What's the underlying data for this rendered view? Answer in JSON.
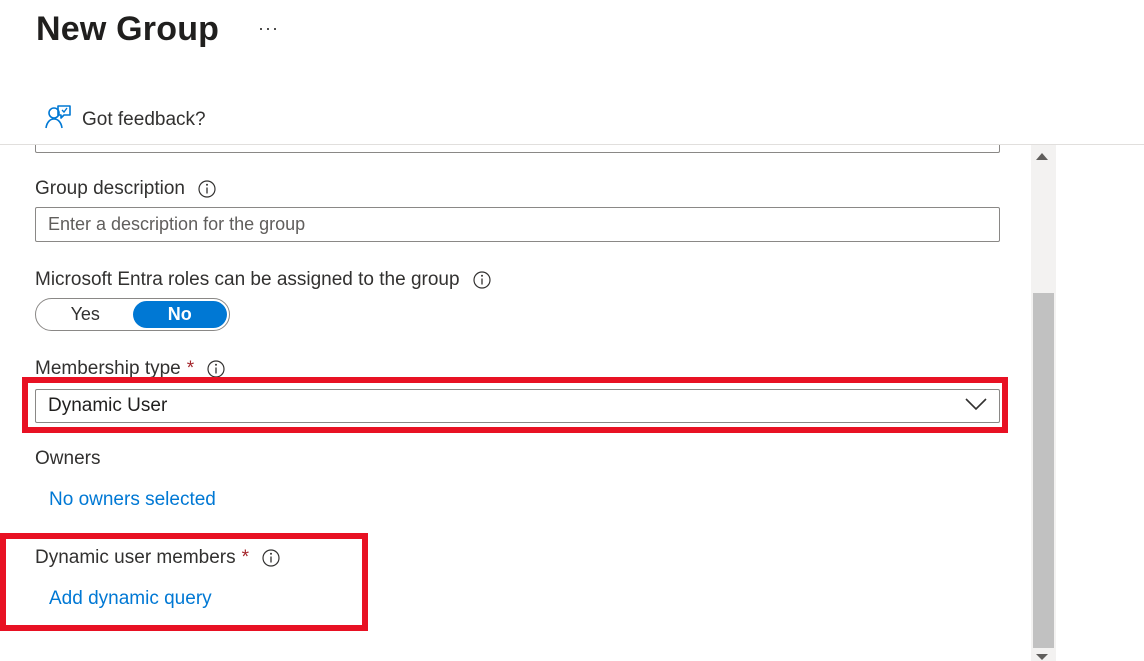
{
  "header": {
    "title": "New Group",
    "more_label": "···"
  },
  "toolbar": {
    "feedback_label": "Got feedback?"
  },
  "form": {
    "description": {
      "label": "Group description",
      "placeholder": "Enter a description for the group",
      "value": ""
    },
    "entra_roles": {
      "label": "Microsoft Entra roles can be assigned to the group",
      "options": [
        "Yes",
        "No"
      ],
      "selected": "No"
    },
    "membership": {
      "label": "Membership type",
      "required_mark": "*",
      "value": "Dynamic User"
    },
    "owners": {
      "label": "Owners",
      "link": "No owners selected"
    },
    "dynamic_members": {
      "label": "Dynamic user members",
      "required_mark": "*",
      "link": "Add dynamic query"
    }
  },
  "colors": {
    "accent": "#0078d4",
    "highlight": "#e81123",
    "required": "#a4262c"
  },
  "icons": {
    "feedback": "feedback-person-icon",
    "info": "info-icon",
    "chevron": "chevron-down-icon"
  }
}
